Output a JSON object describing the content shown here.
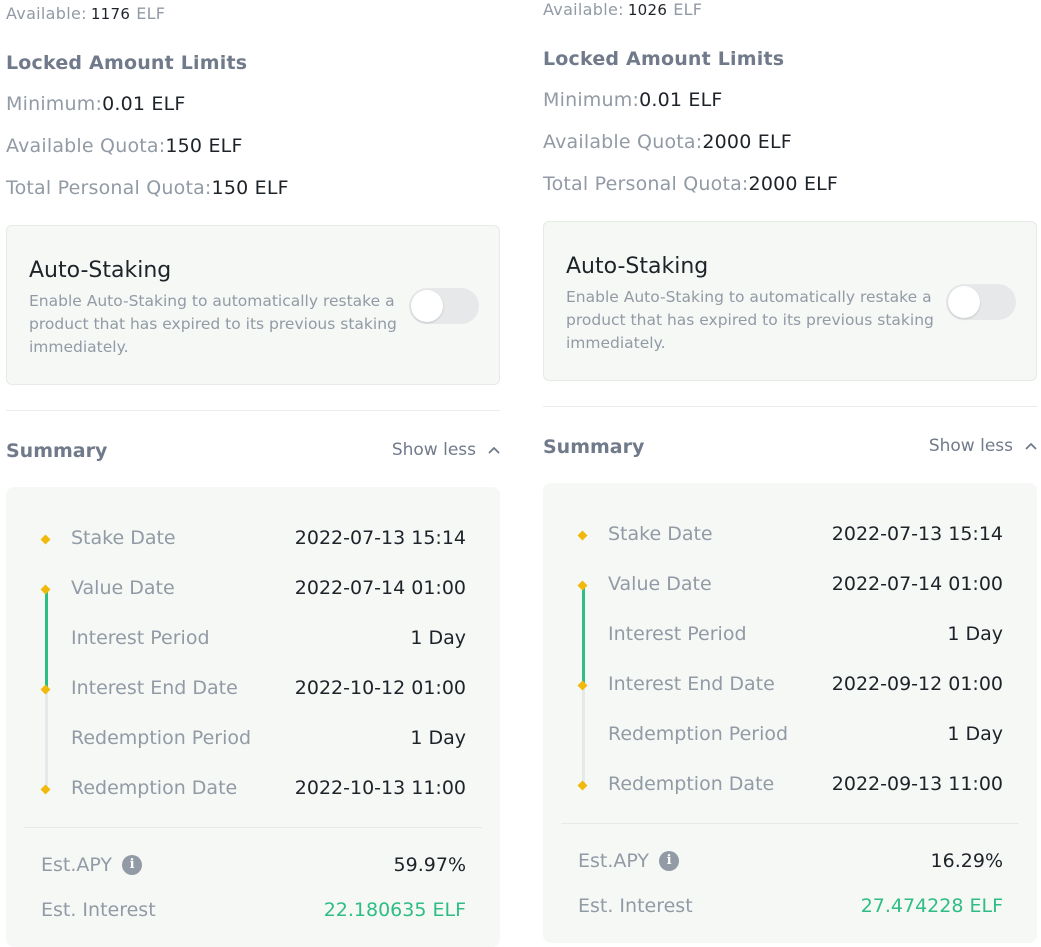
{
  "panels": [
    {
      "available_label": "Available:",
      "available_value": "1176",
      "available_unit": "ELF",
      "limits_title": "Locked Amount Limits",
      "minimum_label": "Minimum:",
      "minimum_value": "0.01 ELF",
      "quota_label": "Available Quota:",
      "quota_value": "150 ELF",
      "total_label": "Total Personal Quota:",
      "total_value": "150 ELF",
      "auto_title": "Auto-Staking",
      "auto_desc": "Enable Auto-Staking to automatically restake a product that has expired to its previous staking immediately.",
      "auto_enabled": false,
      "summary_title": "Summary",
      "show_less": "Show less",
      "timeline": [
        {
          "label": "Stake Date",
          "value": "2022-07-13 15:14"
        },
        {
          "label": "Value Date",
          "value": "2022-07-14 01:00"
        },
        {
          "label": "Interest Period",
          "value": "1 Day"
        },
        {
          "label": "Interest End Date",
          "value": "2022-10-12 01:00"
        },
        {
          "label": "Redemption Period",
          "value": "1 Day"
        },
        {
          "label": "Redemption Date",
          "value": "2022-10-13 11:00"
        }
      ],
      "apy_label": "Est.APY",
      "apy_value": "59.97%",
      "interest_label": "Est. Interest",
      "interest_value": "22.180635 ELF"
    },
    {
      "available_label": "Available:",
      "available_value": "1026",
      "available_unit": "ELF",
      "limits_title": "Locked Amount Limits",
      "minimum_label": "Minimum:",
      "minimum_value": "0.01 ELF",
      "quota_label": "Available Quota:",
      "quota_value": "2000 ELF",
      "total_label": "Total Personal Quota:",
      "total_value": "2000 ELF",
      "auto_title": "Auto-Staking",
      "auto_desc": "Enable Auto-Staking to automatically restake a product that has expired to its previous staking immediately.",
      "auto_enabled": false,
      "summary_title": "Summary",
      "show_less": "Show less",
      "timeline": [
        {
          "label": "Stake Date",
          "value": "2022-07-13 15:14"
        },
        {
          "label": "Value Date",
          "value": "2022-07-14 01:00"
        },
        {
          "label": "Interest Period",
          "value": "1 Day"
        },
        {
          "label": "Interest End Date",
          "value": "2022-09-12 01:00"
        },
        {
          "label": "Redemption Period",
          "value": "1 Day"
        },
        {
          "label": "Redemption Date",
          "value": "2022-09-13 11:00"
        }
      ],
      "apy_label": "Est.APY",
      "apy_value": "16.29%",
      "interest_label": "Est. Interest",
      "interest_value": "27.474228 ELF"
    }
  ],
  "icons": {
    "info": "info-icon",
    "chevron": "chevron-up-icon",
    "timeline_marker": "diamond-icon"
  },
  "colors": {
    "accent_green": "#2ebd85",
    "timeline_marker": "#f0b90b",
    "muted_text": "#929aa5",
    "primary_text": "#1e2329",
    "card_background": "#f5f8f5"
  }
}
